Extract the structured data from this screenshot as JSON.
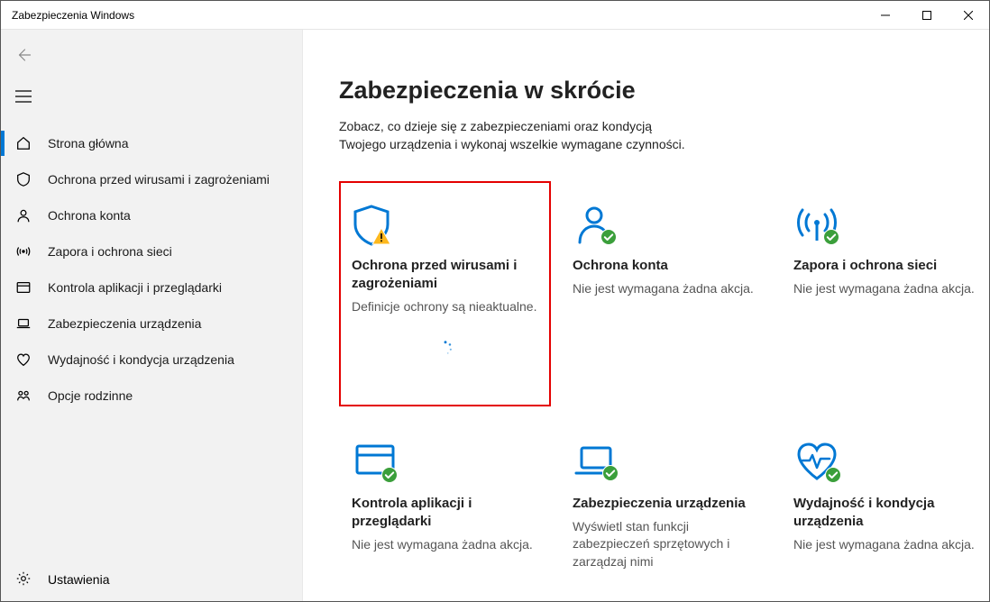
{
  "window": {
    "title": "Zabezpieczenia Windows"
  },
  "sidebar": {
    "items": [
      {
        "label": "Strona główna"
      },
      {
        "label": "Ochrona przed wirusami i zagrożeniami"
      },
      {
        "label": "Ochrona konta"
      },
      {
        "label": "Zapora i ochrona sieci"
      },
      {
        "label": "Kontrola aplikacji i przeglądarki"
      },
      {
        "label": "Zabezpieczenia urządzenia"
      },
      {
        "label": "Wydajność i kondycja urządzenia"
      },
      {
        "label": "Opcje rodzinne"
      }
    ],
    "settings_label": "Ustawienia"
  },
  "main": {
    "heading": "Zabezpieczenia w skrócie",
    "subtitle": "Zobacz, co dzieje się z zabezpieczeniami oraz kondycją Twojego urządzenia i wykonaj wszelkie wymagane czynności."
  },
  "tiles": [
    {
      "title": "Ochrona przed wirusami i zagrożeniami",
      "sub": "Definicje ochrony są nieaktualne."
    },
    {
      "title": "Ochrona konta",
      "sub": "Nie jest wymagana żadna akcja."
    },
    {
      "title": "Zapora i ochrona sieci",
      "sub": "Nie jest wymagana żadna akcja."
    },
    {
      "title": "Kontrola aplikacji i przeglądarki",
      "sub": "Nie jest wymagana żadna akcja."
    },
    {
      "title": "Zabezpieczenia urządzenia",
      "sub": "Wyświetl stan funkcji zabezpieczeń sprzętowych i zarządzaj nimi"
    },
    {
      "title": "Wydajność i kondycja urządzenia",
      "sub": "Nie jest wymagana żadna akcja."
    }
  ],
  "colors": {
    "accent": "#0078d4",
    "ok": "#3b9f3b",
    "warn": "#fdb81e",
    "highlight_border": "#e40000"
  }
}
